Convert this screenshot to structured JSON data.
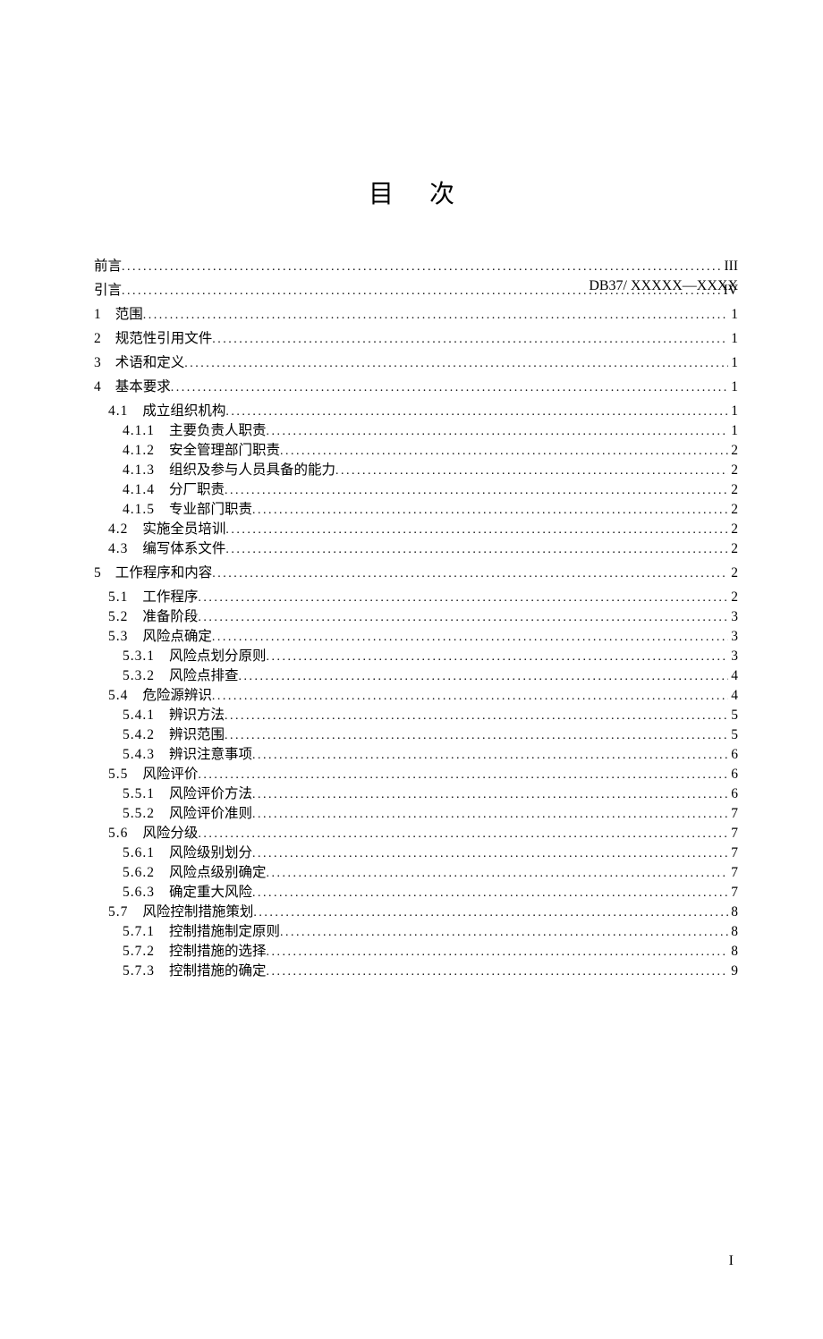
{
  "header": {
    "doc_code": "DB37/ XXXXX—XXXX"
  },
  "title": "目次",
  "toc": {
    "preface": {
      "title": "前言",
      "page": "III"
    },
    "intro": {
      "title": "引言",
      "page": "IV"
    },
    "s1": {
      "num": "1",
      "title": "范围",
      "page": "1"
    },
    "s2": {
      "num": "2",
      "title": "规范性引用文件",
      "page": "1"
    },
    "s3": {
      "num": "3",
      "title": "术语和定义",
      "page": "1"
    },
    "s4": {
      "num": "4",
      "title": "基本要求",
      "page": "1"
    },
    "s4_1": {
      "num": "4.1",
      "title": "成立组织机构",
      "page": "1"
    },
    "s4_1_1": {
      "num": "4.1.1",
      "title": "主要负责人职责",
      "page": "1"
    },
    "s4_1_2": {
      "num": "4.1.2",
      "title": "安全管理部门职责",
      "page": "2"
    },
    "s4_1_3": {
      "num": "4.1.3",
      "title": "组织及参与人员具备的能力",
      "page": "2"
    },
    "s4_1_4": {
      "num": "4.1.4",
      "title": "分厂职责",
      "page": "2"
    },
    "s4_1_5": {
      "num": "4.1.5",
      "title": "专业部门职责",
      "page": "2"
    },
    "s4_2": {
      "num": "4.2",
      "title": "实施全员培训",
      "page": "2"
    },
    "s4_3": {
      "num": "4.3",
      "title": "编写体系文件",
      "page": "2"
    },
    "s5": {
      "num": "5",
      "title": "工作程序和内容",
      "page": "2"
    },
    "s5_1": {
      "num": "5.1",
      "title": "工作程序",
      "page": "2"
    },
    "s5_2": {
      "num": "5.2",
      "title": "准备阶段",
      "page": "3"
    },
    "s5_3": {
      "num": "5.3",
      "title": "风险点确定",
      "page": "3"
    },
    "s5_3_1": {
      "num": "5.3.1",
      "title": "风险点划分原则",
      "page": "3"
    },
    "s5_3_2": {
      "num": "5.3.2",
      "title": "风险点排查",
      "page": "4"
    },
    "s5_4": {
      "num": "5.4",
      "title": "危险源辨识",
      "page": "4"
    },
    "s5_4_1": {
      "num": "5.4.1",
      "title": "辨识方法",
      "page": "5"
    },
    "s5_4_2": {
      "num": "5.4.2",
      "title": "辨识范围",
      "page": "5"
    },
    "s5_4_3": {
      "num": "5.4.3",
      "title": "辨识注意事项",
      "page": "6"
    },
    "s5_5": {
      "num": "5.5",
      "title": "风险评价",
      "page": "6"
    },
    "s5_5_1": {
      "num": "5.5.1",
      "title": "风险评价方法",
      "page": "6"
    },
    "s5_5_2": {
      "num": "5.5.2",
      "title": "风险评价准则",
      "page": "7"
    },
    "s5_6": {
      "num": "5.6",
      "title": "风险分级",
      "page": "7"
    },
    "s5_6_1": {
      "num": "5.6.1",
      "title": "风险级别划分",
      "page": "7"
    },
    "s5_6_2": {
      "num": "5.6.2",
      "title": "风险点级别确定",
      "page": "7"
    },
    "s5_6_3": {
      "num": "5.6.3",
      "title": "确定重大风险",
      "page": "7"
    },
    "s5_7": {
      "num": "5.7",
      "title": "风险控制措施策划",
      "page": "8"
    },
    "s5_7_1": {
      "num": "5.7.1",
      "title": "控制措施制定原则",
      "page": "8"
    },
    "s5_7_2": {
      "num": "5.7.2",
      "title": "控制措施的选择",
      "page": "8"
    },
    "s5_7_3": {
      "num": "5.7.3",
      "title": "控制措施的确定",
      "page": "9"
    }
  },
  "footer": {
    "page_number": "I"
  }
}
